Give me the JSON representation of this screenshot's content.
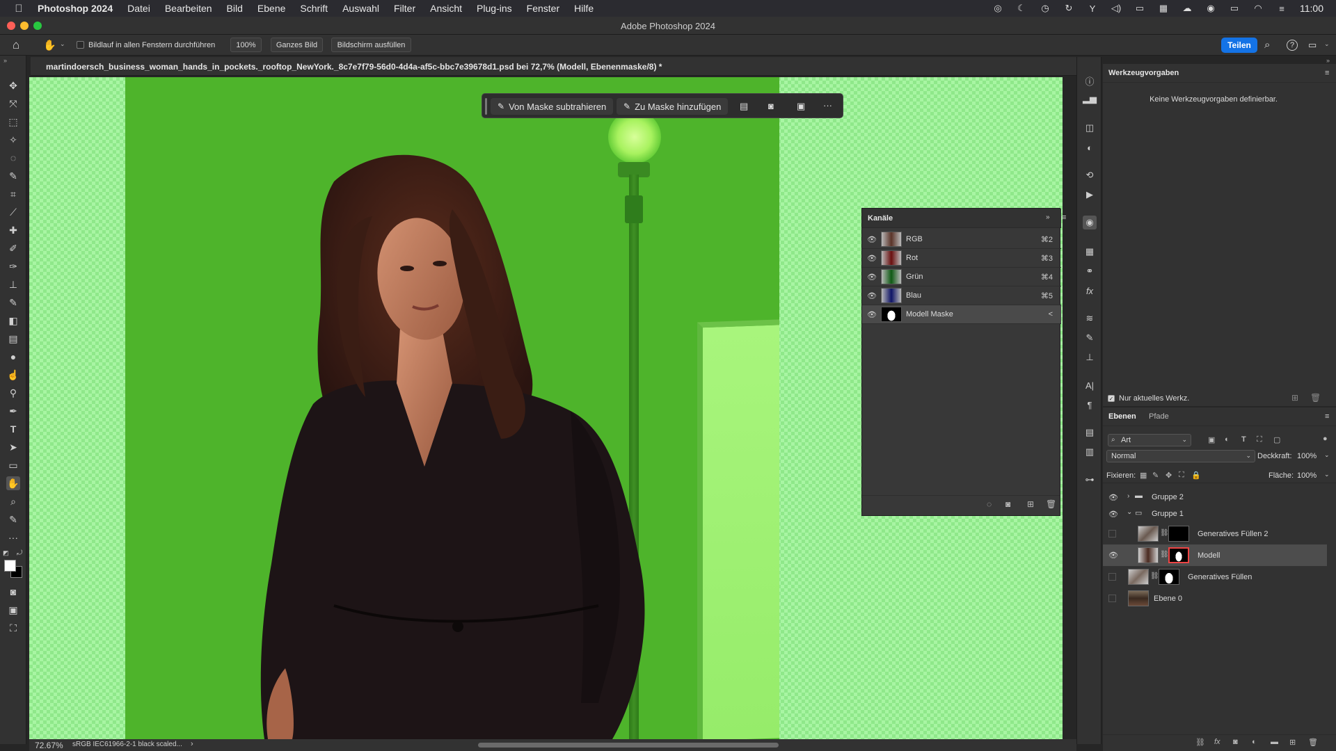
{
  "menubar": {
    "apple_icon": "apple-logo-icon",
    "app_name": "Photoshop 2024",
    "items": [
      "Datei",
      "Bearbeiten",
      "Bild",
      "Ebene",
      "Schrift",
      "Auswahl",
      "Filter",
      "Ansicht",
      "Plug-ins",
      "Fenster",
      "Hilfe"
    ],
    "clock": "11:00"
  },
  "window": {
    "title": "Adobe Photoshop 2024"
  },
  "options_bar": {
    "scroll_all_label": "Bildlauf in allen Fenstern durchführen",
    "zoom_100": "100%",
    "fit_screen": "Ganzes Bild",
    "fill_screen": "Bildschirm ausfüllen",
    "share": "Teilen"
  },
  "document": {
    "tab_title": "martindoersch_business_woman_hands_in_pockets._rooftop_NewYork._8c7e7f79-56d0-4d4a-af5c-bbc7e39678d1.psd bei 72,7% (Modell, Ebenenmaske/8) *"
  },
  "task_bar": {
    "subtract": "Von Maske subtrahieren",
    "add": "Zu Maske hinzufügen",
    "more": "···"
  },
  "channels_panel": {
    "title": "Kanäle",
    "rows": [
      {
        "name": "RGB",
        "shortcut": "⌘2"
      },
      {
        "name": "Rot",
        "shortcut": "⌘3"
      },
      {
        "name": "Grün",
        "shortcut": "⌘4"
      },
      {
        "name": "Blau",
        "shortcut": "⌘5"
      },
      {
        "name": "Modell Maske",
        "shortcut": "<"
      }
    ]
  },
  "presets_panel": {
    "title": "Werkzeugvorgaben",
    "empty_text": "Keine Werkzeugvorgaben definierbar.",
    "only_current": "Nur aktuelles Werkz."
  },
  "layers_panel": {
    "tabs": [
      "Ebenen",
      "Pfade"
    ],
    "filter": "Art",
    "blend_mode": "Normal",
    "opacity_label": "Deckkraft:",
    "opacity_value": "100%",
    "lock_label": "Fixieren:",
    "fill_label": "Fläche:",
    "fill_value": "100%",
    "layers": [
      {
        "name": "Gruppe 2"
      },
      {
        "name": "Gruppe 1"
      },
      {
        "name": "Generatives Füllen 2"
      },
      {
        "name": "Modell"
      },
      {
        "name": "Generatives Füllen"
      },
      {
        "name": "Ebene 0"
      }
    ]
  },
  "status_bar": {
    "zoom": "72.67%",
    "profile": "sRGB IEC61966-2-1 black scaled..."
  }
}
